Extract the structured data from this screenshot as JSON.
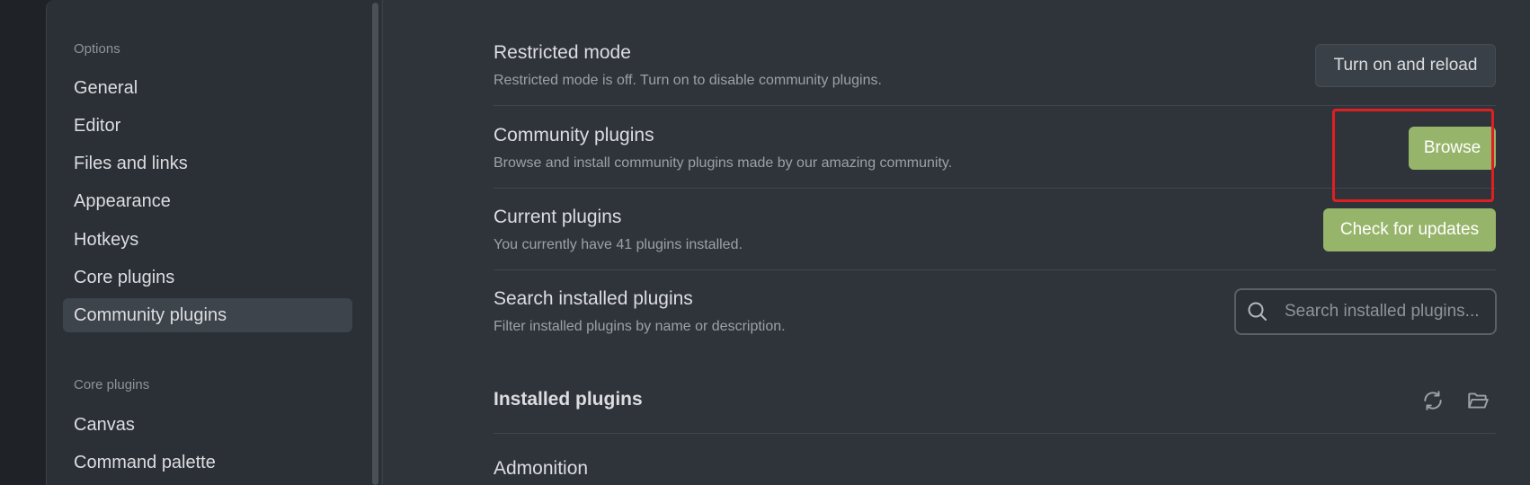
{
  "sidebar": {
    "options_heading": "Options",
    "options_items": [
      {
        "label": "General"
      },
      {
        "label": "Editor"
      },
      {
        "label": "Files and links"
      },
      {
        "label": "Appearance"
      },
      {
        "label": "Hotkeys"
      },
      {
        "label": "Core plugins"
      },
      {
        "label": "Community plugins",
        "active": true
      }
    ],
    "core_heading": "Core plugins",
    "core_items": [
      {
        "label": "Canvas"
      },
      {
        "label": "Command palette"
      }
    ]
  },
  "main": {
    "rows": [
      {
        "title": "Restricted mode",
        "desc": "Restricted mode is off. Turn on to disable community plugins.",
        "button": "Turn on and reload"
      },
      {
        "title": "Community plugins",
        "desc": "Browse and install community plugins made by our amazing community.",
        "button": "Browse"
      },
      {
        "title": "Current plugins",
        "desc": "You currently have 41 plugins installed.",
        "button": "Check for updates"
      },
      {
        "title": "Search installed plugins",
        "desc": "Filter installed plugins by name or description."
      }
    ],
    "search_placeholder": "Search installed plugins...",
    "installed_title": "Installed plugins",
    "first_plugin": "Admonition"
  },
  "colors": {
    "accent_green": "#97b56a",
    "highlight_red": "#e02020",
    "background": "#2f343b"
  },
  "icons": [
    "close-icon",
    "search-icon",
    "reload-icon",
    "folder-open-icon"
  ]
}
